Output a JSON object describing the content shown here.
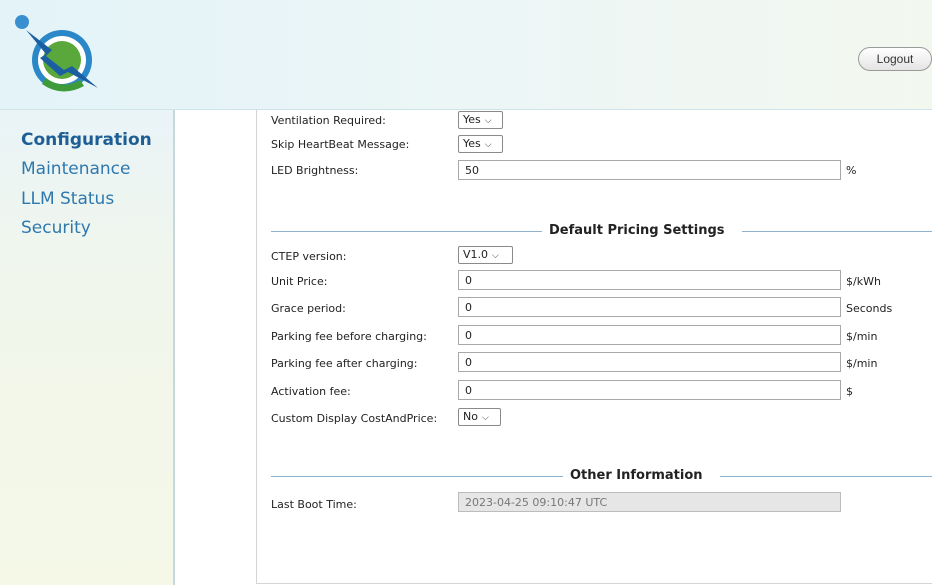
{
  "header": {
    "logout_label": "Logout"
  },
  "sidebar": {
    "items": [
      {
        "label": "Configuration",
        "active": true
      },
      {
        "label": "Maintenance",
        "active": false
      },
      {
        "label": "LLM Status",
        "active": false
      },
      {
        "label": "Security",
        "active": false
      }
    ]
  },
  "general": {
    "ventilation_required": {
      "label": "Ventilation Required:",
      "value": "Yes"
    },
    "skip_heartbeat": {
      "label": "Skip HeartBeat Message:",
      "value": "Yes"
    },
    "led_brightness": {
      "label": "LED Brightness:",
      "value": "50",
      "unit": "%"
    }
  },
  "pricing": {
    "title": "Default Pricing Settings",
    "ctep_version": {
      "label": "CTEP version:",
      "value": "V1.0"
    },
    "unit_price": {
      "label": "Unit Price:",
      "value": "0",
      "unit": "$/kWh"
    },
    "grace_period": {
      "label": "Grace period:",
      "value": "0",
      "unit": "Seconds"
    },
    "parking_before": {
      "label": "Parking fee before charging:",
      "value": "0",
      "unit": "$/min"
    },
    "parking_after": {
      "label": "Parking fee after charging:",
      "value": "0",
      "unit": "$/min"
    },
    "activation_fee": {
      "label": "Activation fee:",
      "value": "0",
      "unit": "$"
    },
    "custom_display": {
      "label": "Custom Display CostAndPrice:",
      "value": "No"
    }
  },
  "other": {
    "title": "Other Information",
    "last_boot": {
      "label": "Last Boot Time:",
      "value": "2023-04-25 09:10:47 UTC"
    }
  },
  "colors": {
    "nav_link": "#2f78ad",
    "section_line": "#8fb2cf",
    "logo_blue": "#2a87c8",
    "logo_green": "#5aa83c"
  },
  "icons": {
    "logo": "brand-logo-icon",
    "select_chevron": "chevron-down-icon"
  }
}
